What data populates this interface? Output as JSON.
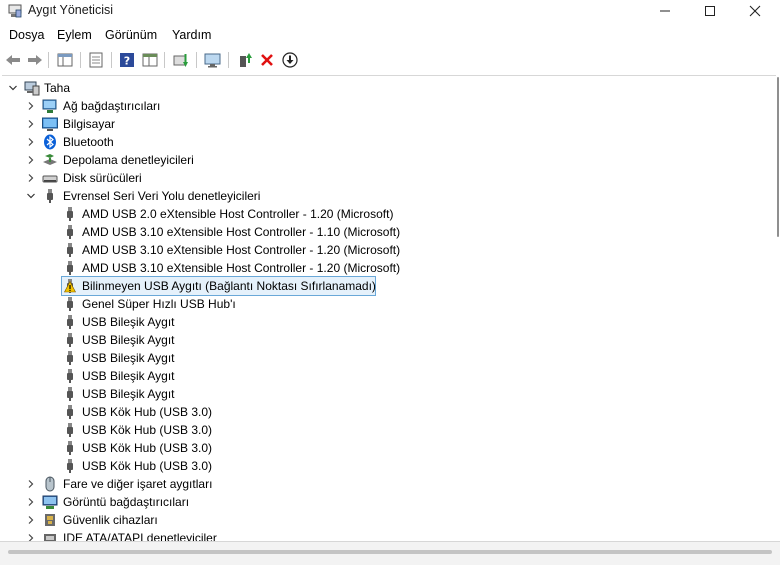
{
  "window": {
    "title": "Aygıt Yöneticisi",
    "buttons": [
      "minimize",
      "maximize",
      "close"
    ]
  },
  "menu": {
    "items": [
      "Dosya",
      "Eylem",
      "Görünüm",
      "Yardım"
    ]
  },
  "toolbar": {
    "icons": [
      "back-arrow-icon",
      "forward-arrow-icon",
      "properties-icon",
      "show-hide-console-tree-icon",
      "help-icon",
      "view-icon",
      "update-driver-icon",
      "scan-hardware-icon",
      "enable-device-icon",
      "uninstall-icon",
      "download-icon"
    ]
  },
  "tree": {
    "root": "Taha",
    "categories_before": [
      {
        "label": "Ağ bağdaştırıcıları",
        "icon": "network-adapter-icon"
      },
      {
        "label": "Bilgisayar",
        "icon": "computer-icon"
      },
      {
        "label": "Bluetooth",
        "icon": "bluetooth-icon"
      },
      {
        "label": "Depolama denetleyicileri",
        "icon": "storage-controller-icon"
      },
      {
        "label": "Disk sürücüleri",
        "icon": "disk-drive-icon"
      }
    ],
    "expanded_category": {
      "label": "Evrensel Seri Veri Yolu denetleyicileri",
      "icon": "usb-icon"
    },
    "usb_devices": [
      {
        "label": "AMD USB 2.0 eXtensible Host Controller - 1.20 (Microsoft)",
        "warning": false
      },
      {
        "label": "AMD USB 3.10 eXtensible Host Controller - 1.10 (Microsoft)",
        "warning": false
      },
      {
        "label": "AMD USB 3.10 eXtensible Host Controller - 1.20 (Microsoft)",
        "warning": false
      },
      {
        "label": "AMD USB 3.10 eXtensible Host Controller - 1.20 (Microsoft)",
        "warning": false
      },
      {
        "label": "Bilinmeyen USB Aygıtı (Bağlantı Noktası Sıfırlanamadı)",
        "warning": true
      },
      {
        "label": "Genel Süper Hızlı USB Hub'ı",
        "warning": false
      },
      {
        "label": "USB Bileşik Aygıt",
        "warning": false
      },
      {
        "label": "USB Bileşik Aygıt",
        "warning": false
      },
      {
        "label": "USB Bileşik Aygıt",
        "warning": false
      },
      {
        "label": "USB Bileşik Aygıt",
        "warning": false
      },
      {
        "label": "USB Bileşik Aygıt",
        "warning": false
      },
      {
        "label": "USB Kök Hub (USB 3.0)",
        "warning": false
      },
      {
        "label": "USB Kök Hub (USB 3.0)",
        "warning": false
      },
      {
        "label": "USB Kök Hub (USB 3.0)",
        "warning": false
      },
      {
        "label": "USB Kök Hub (USB 3.0)",
        "warning": false
      }
    ],
    "categories_after": [
      {
        "label": "Fare ve diğer işaret aygıtları",
        "icon": "mouse-icon"
      },
      {
        "label": "Görüntü bağdaştırıcıları",
        "icon": "display-adapter-icon"
      },
      {
        "label": "Güvenlik cihazları",
        "icon": "security-device-icon"
      },
      {
        "label": "IDE ATA/ATAPI denetleyiciler",
        "icon": "ide-controller-icon"
      }
    ]
  },
  "colors": {
    "selection_bg": "#e5f1fb",
    "selection_border": "#6aa8d8",
    "warning": "#f2c200"
  }
}
